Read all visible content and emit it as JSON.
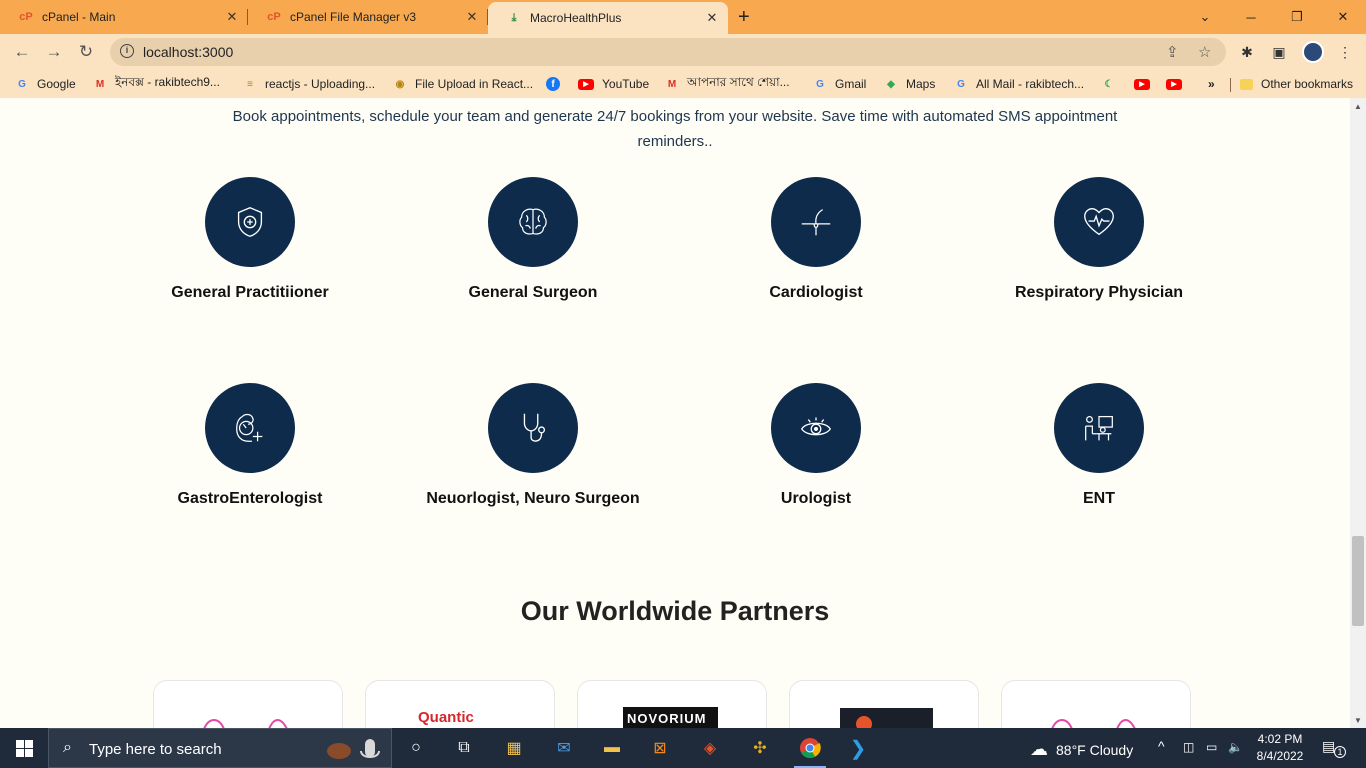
{
  "browser": {
    "tabs": [
      {
        "title": "cPanel - Main",
        "icon": "cpanel-icon"
      },
      {
        "title": "cPanel File Manager v3",
        "icon": "cpanel-icon"
      },
      {
        "title": "MacroHealthPlus",
        "icon": "download-icon",
        "active": true
      }
    ],
    "url": "localhost:3000",
    "bookmarks": [
      {
        "label": "Google",
        "icon": "google-icon"
      },
      {
        "label": "ইনবক্স - rakibtech9...",
        "icon": "gmail-icon"
      },
      {
        "label": "reactjs - Uploading...",
        "icon": "stackoverflow-icon"
      },
      {
        "label": "File Upload in React...",
        "icon": "page-icon"
      },
      {
        "label": "",
        "icon": "facebook-icon"
      },
      {
        "label": "YouTube",
        "icon": "youtube-icon"
      },
      {
        "label": "আপনার সাথে শেয়া...",
        "icon": "gmail-icon"
      },
      {
        "label": "Gmail",
        "icon": "google-icon"
      },
      {
        "label": "Maps",
        "icon": "maps-icon"
      },
      {
        "label": "All Mail - rakibtech...",
        "icon": "google-icon"
      }
    ],
    "more_bookmarks": "»",
    "other_bookmarks": "Other bookmarks"
  },
  "page": {
    "intro": "Book appointments, schedule your team and generate 24/7 bookings from your website. Save time with automated SMS appointment reminders..",
    "specialties": [
      {
        "label": "General Practitiioner",
        "icon": "shield-plus-icon"
      },
      {
        "label": "General Surgeon",
        "icon": "brain-icon"
      },
      {
        "label": "Cardiologist",
        "icon": "hair-follicle-icon"
      },
      {
        "label": "Respiratory Physician",
        "icon": "heart-pulse-icon"
      },
      {
        "label": "GastroEnterologist",
        "icon": "stomach-plus-icon"
      },
      {
        "label": "Neuorlogist, Neuro Surgeon",
        "icon": "stethoscope-icon"
      },
      {
        "label": "Urologist",
        "icon": "eye-icon"
      },
      {
        "label": "ENT",
        "icon": "consultation-icon"
      }
    ],
    "partners_title": "Our Worldwide Partners",
    "partners": [
      "partner-logo-1",
      "Quantic",
      "NOVORIUM",
      "partner-logo-4",
      "partner-logo-5"
    ]
  },
  "taskbar": {
    "search_placeholder": "Type here to search",
    "weather": "88°F  Cloudy",
    "time": "4:02 PM",
    "date": "8/4/2022",
    "notifications": "1"
  },
  "colors": {
    "tab_strip": "#f8a94f",
    "toolbar": "#fbe3c2",
    "page_bg": "#fefef6",
    "icon_circle": "#0f2b4b",
    "taskbar": "#1f2a3a"
  }
}
